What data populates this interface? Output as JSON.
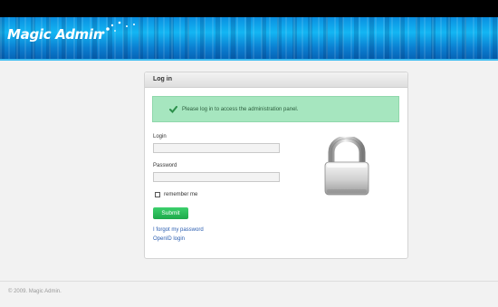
{
  "header": {
    "logo_text": "Magic Admin",
    "brand_color": "#0a8fe0"
  },
  "panel": {
    "title": "Log in",
    "notice": "Please log in to access the administration panel.",
    "notice_color": "#a6e6bf",
    "login_label": "Login",
    "login_value": "",
    "password_label": "Password",
    "password_value": "",
    "remember_label": "remember me",
    "remember_checked": false,
    "submit_label": "Submit",
    "submit_color": "#2cbb5a",
    "forgot_link": "I forgot my password",
    "openid_link": "OpenID login",
    "illustration": "padlock-icon"
  },
  "footer": {
    "text": "© 2009. Magic Admin."
  }
}
